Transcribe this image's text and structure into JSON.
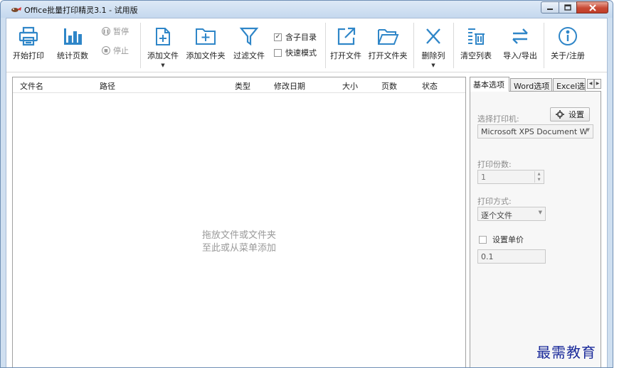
{
  "window": {
    "title": "Office批量打印精灵3.1 - 试用版"
  },
  "toolbar": {
    "start_print": "开始打印",
    "count_pages": "统计页数",
    "pause": "暂停",
    "stop": "停止",
    "add_file": "添加文件",
    "add_folder": "添加文件夹",
    "filter_file": "过滤文件",
    "include_subdir": "含子目录",
    "include_subdir_checked": true,
    "fast_mode": "快速模式",
    "fast_mode_checked": false,
    "open_file": "打开文件",
    "open_folder": "打开文件夹",
    "delete_column": "删除列",
    "clear_list": "清空列表",
    "import_export": "导入/导出",
    "about_register": "关于/注册"
  },
  "file_list": {
    "columns": [
      "文件名",
      "路径",
      "类型",
      "修改日期",
      "大小",
      "页数",
      "状态"
    ],
    "empty_line1": "拖放文件或文件夹",
    "empty_line2": "至此或从菜单添加"
  },
  "options_panel": {
    "tabs": [
      "基本选项",
      "Word选项",
      "Excel选"
    ],
    "active_tab": "基本选项",
    "select_printer_label": "选择打印机:",
    "settings_button": "设置",
    "printer_value": "Microsoft XPS Document W",
    "copies_label": "打印份数:",
    "copies_value": "1",
    "print_mode_label": "打印方式:",
    "print_mode_value": "逐个文件",
    "set_unit_price_label": "设置单价",
    "unit_price_value": "0.1"
  },
  "watermark": {
    "text": "最需教育"
  },
  "colors": {
    "accent_icon": "#2f86c8",
    "title_bg": "#cfdff0",
    "close_red": "#c84a35"
  }
}
